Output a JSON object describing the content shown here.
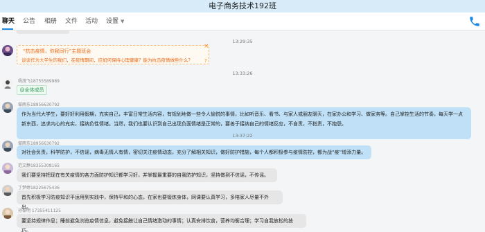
{
  "window": {
    "title": "电子商务技术192班"
  },
  "tabs": [
    {
      "label": "聊天",
      "active": true
    },
    {
      "label": "公告"
    },
    {
      "label": "相册"
    },
    {
      "label": "文件"
    },
    {
      "label": "活动"
    },
    {
      "label": "设置"
    }
  ],
  "timestamps": [
    "13:29:35",
    "13:33:26",
    "13:37:22"
  ],
  "notice_card": {
    "title": "“抗击疫情，你我同行”主题班会",
    "body": "谈谈作为大学生的我们，在疫情期间，应如何保持心理健康？能为抗击疫情做些什么？"
  },
  "messages": [
    {
      "sender": "杨茂飞18755589989",
      "text": "@全体成员",
      "style": "mention"
    },
    {
      "sender": "邹雨东18956630792",
      "text": "作为当代大学生，要好好利用假期，充实自己，丰富日常生活内容，有规划地做一些令人愉悦的事情，比如听音乐、看书、与家人或朋友聊天，在家办公和学习、做家务等。自己掌控生活的节奏，每天学一点新东西，追求内心的充实，接纳负性情绪。当然，我们也要认识到自己出现负面情绪是正常的，要善于接纳自己的情绪反应，不自责，不指责，不抱怨。",
      "style": "blue"
    },
    {
      "sender": "邹雨东18956630792",
      "text": "对社会负责，科学防护，不信谣，病毒无情人有情，密切关注疫情动态，充分了解相关知识，做好防护措施，每个人都积极参与疫情防控，都为战“疫”增添力量。",
      "style": "blue"
    },
    {
      "sender": "范文静18355308165",
      "text": "我们要坚持把现在有关疫情的各方面防护知识都学习好，并掌握最重要的自我防护知识，坚持做到不信谣，不传谣。",
      "style": "grey"
    },
    {
      "sender": "丁梦婷18225675436",
      "text": "首先积极学习防疫知识平运用到实践中，保持平和的心态，在家也要锻炼身体，网课要认真学习，多陪家人尽量不外出。",
      "style": "grey"
    },
    {
      "sender": "孙黎明    17355411125",
      "text": "要坚持规律作息；睡前避免浏览疫情信息，避免接触让自己情绪激动的事情；认真安排饮食，营养均衡合理；学习自我放松的技巧。",
      "style": "grey"
    }
  ],
  "colors": {
    "title_bar": "#d7ecf8",
    "accent": "#1e88e5",
    "bubble_self": "#bfe0f6",
    "bubble_other": "#e6e6e6",
    "notice": "#ea6a18"
  }
}
